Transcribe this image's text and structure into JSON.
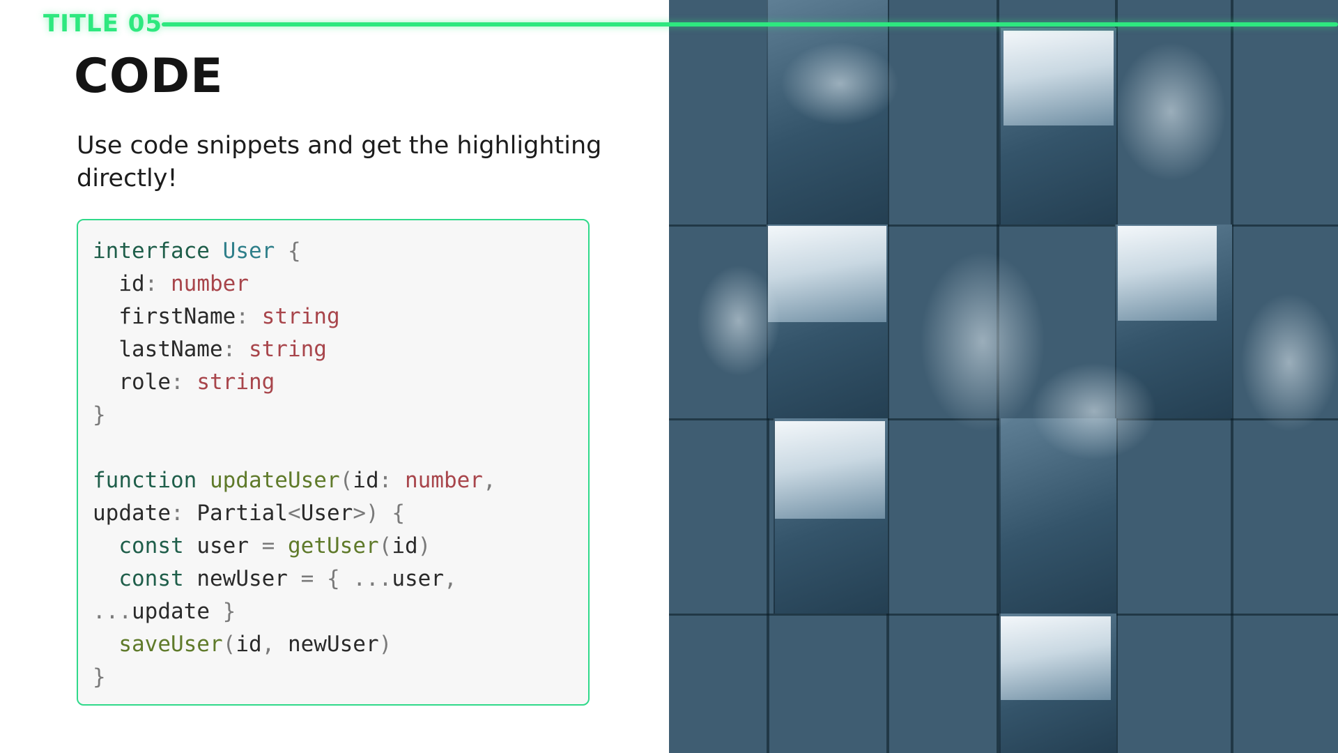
{
  "header": {
    "label": "TITLE 05",
    "accent_color": "#2ee87f"
  },
  "slide": {
    "heading": "CODE",
    "subtitle": "Use code snippets and get the highlighting directly!"
  },
  "code": {
    "language": "typescript",
    "lines": [
      "interface User {",
      "  id: number",
      "  firstName: string",
      "  lastName: string",
      "  role: string",
      "}",
      "",
      "function updateUser(id: number,",
      "update: Partial<User>) {",
      "  const user = getUser(id)",
      "  const newUser = { ...user,",
      "...update }",
      "  saveUser(id, newUser)",
      "}"
    ]
  },
  "image": {
    "subject": "abstract-blue-cubes-photo"
  }
}
